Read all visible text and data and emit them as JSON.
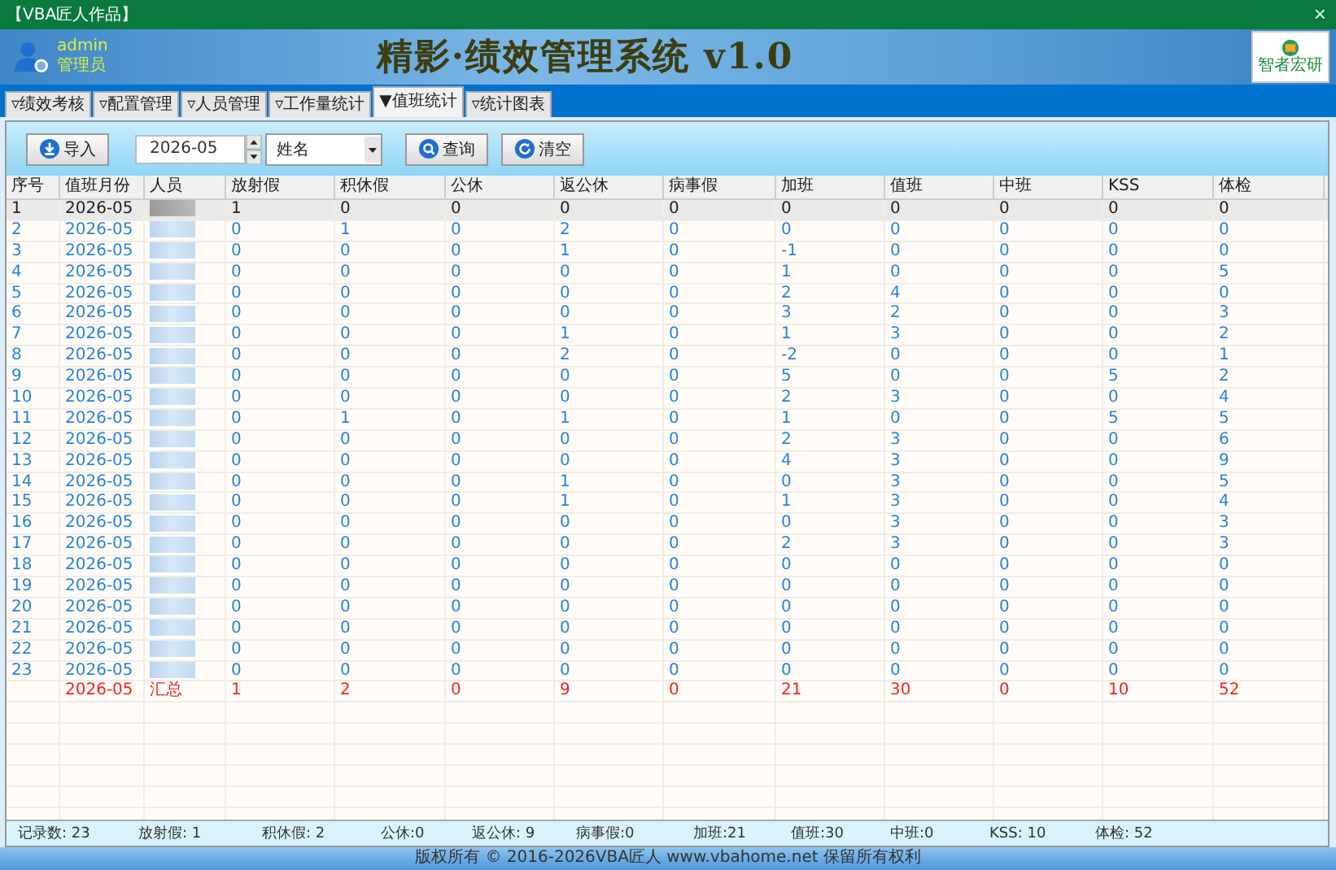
{
  "window": {
    "title": "【VBA匠人作品】",
    "close": "×"
  },
  "header": {
    "user": "admin",
    "role": "管理员",
    "title": "精影·绩效管理系统 v1.0",
    "logo_text": "智者宏研"
  },
  "tabs": [
    {
      "label": "▿绩效考核",
      "selected": false
    },
    {
      "label": "▿配置管理",
      "selected": false
    },
    {
      "label": "▿人员管理",
      "selected": false
    },
    {
      "label": "▿工作量统计",
      "selected": false
    },
    {
      "label": "▼值班统计",
      "selected": true
    },
    {
      "label": "▿统计图表",
      "selected": false
    }
  ],
  "toolbar": {
    "import_button": "导入",
    "month": "2026-05",
    "field": "姓名",
    "query_button": "查询",
    "clear_button": "清空"
  },
  "table": {
    "columns": [
      "序号",
      "值班月份",
      "人员",
      "放射假",
      "积休假",
      "公休",
      "返公休",
      "病事假",
      "加班",
      "值班",
      "中班",
      "KSS",
      "体检"
    ],
    "rows": [
      {
        "kind": "data",
        "selected": true,
        "no": "1",
        "month": "2026-05",
        "values": [
          "1",
          "0",
          "0",
          "0",
          "0",
          "0",
          "0",
          "0",
          "0",
          "0"
        ]
      },
      {
        "kind": "data",
        "selected": false,
        "no": "2",
        "month": "2026-05",
        "values": [
          "0",
          "1",
          "0",
          "2",
          "0",
          "0",
          "0",
          "0",
          "0",
          "0"
        ]
      },
      {
        "kind": "data",
        "selected": false,
        "no": "3",
        "month": "2026-05",
        "values": [
          "0",
          "0",
          "0",
          "1",
          "0",
          "-1",
          "0",
          "0",
          "0",
          "0"
        ]
      },
      {
        "kind": "data",
        "selected": false,
        "no": "4",
        "month": "2026-05",
        "values": [
          "0",
          "0",
          "0",
          "0",
          "0",
          "1",
          "0",
          "0",
          "0",
          "5"
        ]
      },
      {
        "kind": "data",
        "selected": false,
        "no": "5",
        "month": "2026-05",
        "values": [
          "0",
          "0",
          "0",
          "0",
          "0",
          "2",
          "4",
          "0",
          "0",
          "0"
        ]
      },
      {
        "kind": "data",
        "selected": false,
        "no": "6",
        "month": "2026-05",
        "values": [
          "0",
          "0",
          "0",
          "0",
          "0",
          "3",
          "2",
          "0",
          "0",
          "3"
        ]
      },
      {
        "kind": "data",
        "selected": false,
        "no": "7",
        "month": "2026-05",
        "values": [
          "0",
          "0",
          "0",
          "1",
          "0",
          "1",
          "3",
          "0",
          "0",
          "2"
        ]
      },
      {
        "kind": "data",
        "selected": false,
        "no": "8",
        "month": "2026-05",
        "values": [
          "0",
          "0",
          "0",
          "2",
          "0",
          "-2",
          "0",
          "0",
          "0",
          "1"
        ]
      },
      {
        "kind": "data",
        "selected": false,
        "no": "9",
        "month": "2026-05",
        "values": [
          "0",
          "0",
          "0",
          "0",
          "0",
          "5",
          "0",
          "0",
          "5",
          "2"
        ]
      },
      {
        "kind": "data",
        "selected": false,
        "no": "10",
        "month": "2026-05",
        "values": [
          "0",
          "0",
          "0",
          "0",
          "0",
          "2",
          "3",
          "0",
          "0",
          "4"
        ]
      },
      {
        "kind": "data",
        "selected": false,
        "no": "11",
        "month": "2026-05",
        "values": [
          "0",
          "1",
          "0",
          "1",
          "0",
          "1",
          "0",
          "0",
          "5",
          "5"
        ]
      },
      {
        "kind": "data",
        "selected": false,
        "no": "12",
        "month": "2026-05",
        "values": [
          "0",
          "0",
          "0",
          "0",
          "0",
          "2",
          "3",
          "0",
          "0",
          "6"
        ]
      },
      {
        "kind": "data",
        "selected": false,
        "no": "13",
        "month": "2026-05",
        "values": [
          "0",
          "0",
          "0",
          "0",
          "0",
          "4",
          "3",
          "0",
          "0",
          "9"
        ]
      },
      {
        "kind": "data",
        "selected": false,
        "no": "14",
        "month": "2026-05",
        "values": [
          "0",
          "0",
          "0",
          "1",
          "0",
          "0",
          "3",
          "0",
          "0",
          "5"
        ]
      },
      {
        "kind": "data",
        "selected": false,
        "no": "15",
        "month": "2026-05",
        "values": [
          "0",
          "0",
          "0",
          "1",
          "0",
          "1",
          "3",
          "0",
          "0",
          "4"
        ]
      },
      {
        "kind": "data",
        "selected": false,
        "no": "16",
        "month": "2026-05",
        "values": [
          "0",
          "0",
          "0",
          "0",
          "0",
          "0",
          "3",
          "0",
          "0",
          "3"
        ]
      },
      {
        "kind": "data",
        "selected": false,
        "no": "17",
        "month": "2026-05",
        "values": [
          "0",
          "0",
          "0",
          "0",
          "0",
          "2",
          "3",
          "0",
          "0",
          "3"
        ]
      },
      {
        "kind": "data",
        "selected": false,
        "no": "18",
        "month": "2026-05",
        "values": [
          "0",
          "0",
          "0",
          "0",
          "0",
          "0",
          "0",
          "0",
          "0",
          "0"
        ]
      },
      {
        "kind": "data",
        "selected": false,
        "no": "19",
        "month": "2026-05",
        "values": [
          "0",
          "0",
          "0",
          "0",
          "0",
          "0",
          "0",
          "0",
          "0",
          "0"
        ]
      },
      {
        "kind": "data",
        "selected": false,
        "no": "20",
        "month": "2026-05",
        "values": [
          "0",
          "0",
          "0",
          "0",
          "0",
          "0",
          "0",
          "0",
          "0",
          "0"
        ]
      },
      {
        "kind": "data",
        "selected": false,
        "no": "21",
        "month": "2026-05",
        "values": [
          "0",
          "0",
          "0",
          "0",
          "0",
          "0",
          "0",
          "0",
          "0",
          "0"
        ]
      },
      {
        "kind": "data",
        "selected": false,
        "no": "22",
        "month": "2026-05",
        "values": [
          "0",
          "0",
          "0",
          "0",
          "0",
          "0",
          "0",
          "0",
          "0",
          "0"
        ]
      },
      {
        "kind": "data",
        "selected": false,
        "no": "23",
        "month": "2026-05",
        "values": [
          "0",
          "0",
          "0",
          "0",
          "0",
          "0",
          "0",
          "0",
          "0",
          "0"
        ]
      },
      {
        "kind": "total",
        "selected": false,
        "month": "2026-05",
        "person": "汇总",
        "values": [
          "1",
          "2",
          "0",
          "9",
          "0",
          "21",
          "30",
          "0",
          "10",
          "52"
        ]
      }
    ]
  },
  "status_bar": [
    "记录数: 23",
    "放射假: 1",
    "积休假: 2",
    "公休:0",
    "返公休: 9",
    "病事假:0",
    "加班:21",
    "值班:30",
    "中班:0",
    "KSS: 10",
    "体检: 52"
  ],
  "footer": "版权所有 © 2016-2026VBA匠人 www.vbahome.net 保留所有权利"
}
